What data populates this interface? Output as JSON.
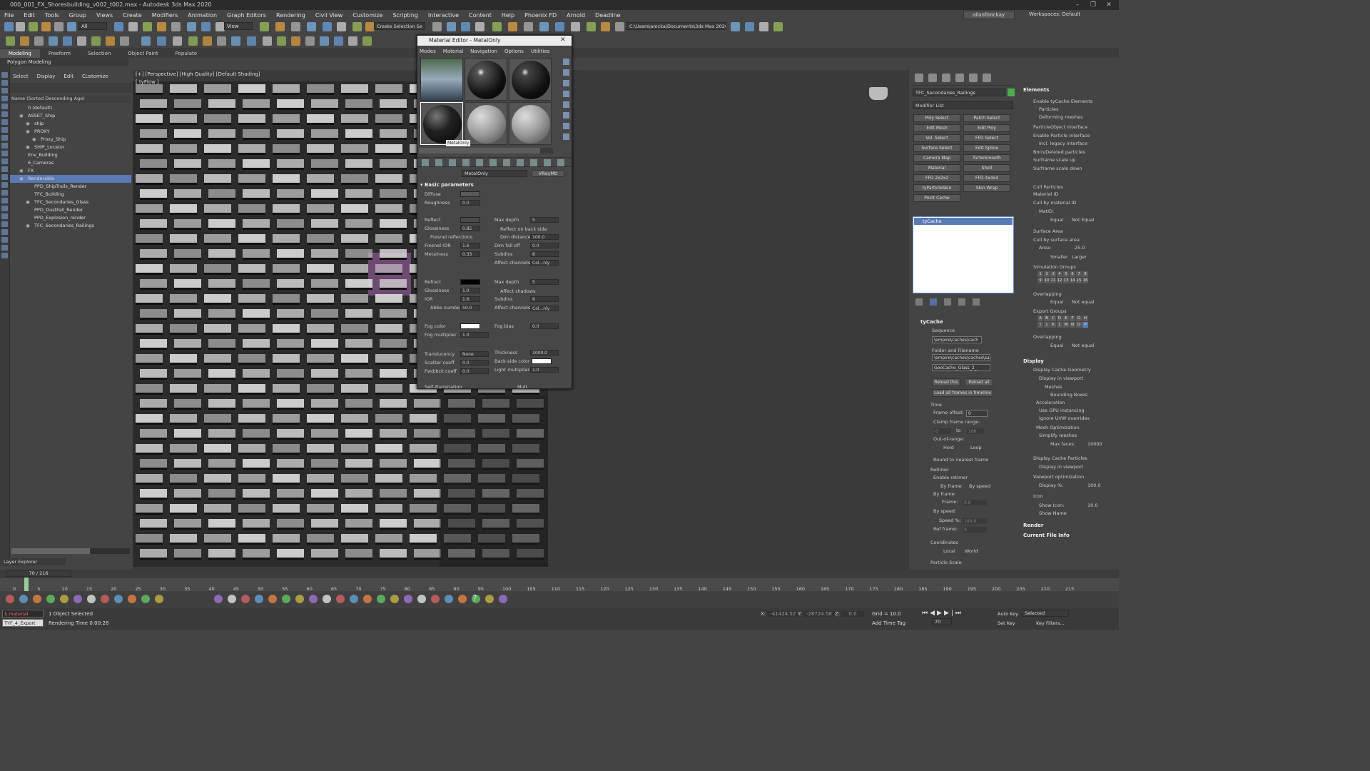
{
  "title_bar": {
    "text": "000_001_FX_Shoresbuilding_v002_t002.max - Autodesk 3ds Max 2020"
  },
  "menu": [
    "File",
    "Edit",
    "Tools",
    "Group",
    "Views",
    "Create",
    "Modifiers",
    "Animation",
    "Graph Editors",
    "Rendering",
    "Civil View",
    "Customize",
    "Scripting",
    "Interactive",
    "Content",
    "Help",
    "Phoenix FD",
    "Arnold",
    "Deadline"
  ],
  "user": {
    "name": "allanftmckay",
    "workspaces_label": "Workspaces:",
    "workspace": "Default"
  },
  "toolbar": {
    "selection_filter": "All",
    "view_dropdown": "View",
    "create_selection_set": "Create Selection Se",
    "path": "C:\\Users\\amcka\\Documents\\3ds Max 2020"
  },
  "ribbon": {
    "tabs": [
      "Modeling",
      "Freeform",
      "Selection",
      "Object Paint",
      "Populate"
    ],
    "active_sub": "Polygon Modeling"
  },
  "scene_explorer": {
    "menu": [
      "Select",
      "Display",
      "Edit",
      "Customize"
    ],
    "header": "Name (Sorted Descending Age)",
    "rows": [
      {
        "label": "0 (default)",
        "indent": 1,
        "eye": false
      },
      {
        "label": "ASSET_Ship",
        "indent": 1,
        "eye": true
      },
      {
        "label": "ship",
        "indent": 2,
        "eye": true
      },
      {
        "label": "PROXY",
        "indent": 2,
        "eye": true
      },
      {
        "label": "Proxy_Ship",
        "indent": 3,
        "eye": true
      },
      {
        "label": "SHIP_Locator",
        "indent": 2,
        "eye": true
      },
      {
        "label": "Env_Building",
        "indent": 1,
        "eye": false
      },
      {
        "label": "6_Cameras",
        "indent": 1,
        "eye": false
      },
      {
        "label": "FX",
        "indent": 1,
        "eye": true
      },
      {
        "label": "Renderable",
        "indent": 1,
        "eye": true,
        "selected": true
      },
      {
        "label": "PPD_ShipTrails_Render",
        "indent": 2,
        "eye": false
      },
      {
        "label": "TFC_Building",
        "indent": 2,
        "eye": false
      },
      {
        "label": "TFC_Secondaries_Glass",
        "indent": 2,
        "eye": true
      },
      {
        "label": "PPD_DustFall_Render",
        "indent": 2,
        "eye": false
      },
      {
        "label": "PPD_Explosion_render",
        "indent": 2,
        "eye": false
      },
      {
        "label": "TFC_Secondaries_Railings",
        "indent": 2,
        "eye": true
      }
    ],
    "layer_explorer": "Layer Explorer"
  },
  "viewport": {
    "label": "[+] [Perspective] [High Quality] [Default Shading]",
    "sublabel": "[ tyFlow ]"
  },
  "material_editor": {
    "title": "Material Editor - MetalOnly",
    "menu": [
      "Modes",
      "Material",
      "Navigation",
      "Options",
      "Utilities"
    ],
    "tooltip": "MetalOnly",
    "material_name": "MetalOnly",
    "material_type": "VRayMtl",
    "rollout": "Basic parameters",
    "diffuse": "Diffuse",
    "roughness": {
      "label": "Roughness",
      "value": "0.0"
    },
    "reflect": {
      "label": "Reflect",
      "max_depth_label": "Max depth",
      "max_depth": "5"
    },
    "glossiness": {
      "label": "Glossiness",
      "value": "0.85",
      "reflect_backside": "Reflect on back side"
    },
    "fresnel": "Fresnel reflections",
    "dim_distance": {
      "label": "Dim distance",
      "value": "100.0"
    },
    "fresnel_ior": {
      "label": "Fresnel IOR",
      "value": "1.6",
      "dim_falloff": "Dim fall off",
      "dim_falloff_value": "0.0"
    },
    "metalness": {
      "label": "Metalness",
      "value": "0.33",
      "subdivs": "Subdivs",
      "subdivs_value": "8"
    },
    "affect_channels_label": "Affect channels",
    "affect_channels": "Col...nly",
    "refract": {
      "label": "Refract",
      "max_depth_label": "Max depth",
      "max_depth": "5"
    },
    "refr_glossiness": {
      "label": "Glossiness",
      "value": "1.0",
      "affect_shadows": "Affect shadows"
    },
    "ior": {
      "label": "IOR",
      "value": "1.6",
      "subdivs": "Subdivs",
      "subdivs_value": "8"
    },
    "abbe": {
      "label": "Abbe number",
      "value": "50.0"
    },
    "fog_color": "Fog color",
    "fog_bias": {
      "label": "Fog bias",
      "value": "0.0"
    },
    "fog_multiplier": {
      "label": "Fog multiplier",
      "value": "1.0"
    },
    "translucency": {
      "label": "Translucency",
      "value": "None",
      "thickness": "Thickness",
      "thickness_value": "1000.0"
    },
    "scatter": {
      "label": "Scatter coeff",
      "value": "0.0",
      "backside": "Back-side color"
    },
    "fwdbck": {
      "label": "Fwd/bck coeff",
      "value": "0.0",
      "light_mult": "Light multiplier",
      "light_mult_value": "1.0"
    },
    "self_illum": "Self-illumination",
    "multi": "Mult"
  },
  "command_panel": {
    "object_name": "TFC_Secondaries_Railings",
    "modifier_list": "Modifier List",
    "buttons": [
      "Poly Select",
      "Patch Select",
      "Edit Mesh",
      "Edit Poly",
      "Vol. Select",
      "FFD Select",
      "Surface Select",
      "Edit Spline",
      "Camera Map",
      "TurboSmooth",
      "Material",
      "Shell",
      "FFD 2x2x2",
      "FFD 4x4x4",
      "tyParticleSkin",
      "Skin Wrap",
      "Point Cache",
      ""
    ],
    "stack_item": "tyCache",
    "tycache": {
      "title": "tyCache",
      "sequence": "Sequence",
      "sequence_path": "\\empire\\caches\\cach",
      "folder_label": "Folder and Filename",
      "folder_path": "\\empire\\caches\\caches\\sa",
      "file": "GeoCache_Glass_2_",
      "reload_this": "Reload this",
      "reload_all": "Reload all",
      "load_all": "Load all frames in timeline",
      "time": "Time",
      "frame_offset": "Frame offset:",
      "frame_offset_value": "0",
      "clamp": "Clamp frame range:",
      "clamp_from": "0",
      "clamp_to_label": "to",
      "clamp_to": "100",
      "out_of_range": "Out-of-range:",
      "hold": "Hold",
      "loop": "Loop",
      "round": "Round to nearest frame",
      "retimer": "Retimer",
      "enable_retimer": "Enable retimer",
      "by_frame": "By frame",
      "by_speed": "By speed",
      "by_frame_label": "By frame:",
      "frame_label": "Frame:",
      "frame_value": "0.0",
      "by_speed_label": "By speed:",
      "speed_pct": "Speed %:",
      "speed_value": "100.0",
      "ref_frame": "Ref frame:",
      "ref_value": "0",
      "coordinates": "Coordinates",
      "local": "Local",
      "world": "World",
      "particle_scale": "Particle Scale"
    },
    "elements": {
      "title": "Elements",
      "enable": "Enable tyCache Elements",
      "particles": "Particles",
      "deforming": "Deforming meshes",
      "pobj_iface": "ParticleObject Interface",
      "enable_pi": "Enable Particle Interface",
      "incl_legacy": "Incl. legacy interface",
      "born_del": "Born/Deleted particles",
      "scale_up": "Surframe scale up",
      "scale_down": "Surframe scale down",
      "cull": "Cull Particles",
      "material_id": "Material ID",
      "cull_matid": "Cull by material ID",
      "matid": "MatID:",
      "equal": "Equal",
      "not_equal": "Not Equal",
      "surface_area": "Surface Area",
      "cull_surf": "Cull by surface area",
      "area": "Area:",
      "area_value": "25.0",
      "smaller": "Smaller",
      "larger": "Larger",
      "sim_groups": "Simulation Groups",
      "overlapping": "Overlapping",
      "equal2": "Equal",
      "not_equal2": "Not equal",
      "export_groups": "Export Groups",
      "overlapping2": "Overlapping",
      "equal3": "Equal",
      "not_equal3": "Not equal"
    },
    "display": {
      "title": "Display",
      "cache_geom": "Display Cache Geometry",
      "in_viewport": "Display in viewport",
      "meshes": "Meshes",
      "bboxes": "Bounding Boxes",
      "accel": "Acceleration",
      "gpu": "Use GPU instancing",
      "uvw": "Ignore UVW overrides",
      "mesh_opt": "Mesh Optimization",
      "simplify": "Simplify meshes",
      "max_faces": "Max faces:",
      "max_faces_value": "10000",
      "cache_particles": "Display Cache Particles",
      "in_viewport2": "Display in viewport",
      "vp_opt": "Viewport optimization",
      "display_pct": "Display %:",
      "display_pct_value": "100.0",
      "icon": "Icon",
      "show_icon": "Show Icon:",
      "icon_size": "10.0",
      "show_name": "Show Name"
    },
    "render": "Render",
    "current_file": "Current File Info"
  },
  "timeline": {
    "frame": "70 / 216",
    "ticks": [
      "0",
      "5",
      "10",
      "15",
      "20",
      "25",
      "30",
      "35",
      "40",
      "45",
      "50",
      "55",
      "60",
      "65",
      "70",
      "75",
      "80",
      "85",
      "90",
      "95",
      "100",
      "105",
      "110",
      "115",
      "120",
      "125",
      "130",
      "135",
      "140",
      "145",
      "150",
      "155",
      "160",
      "165",
      "170",
      "175",
      "180",
      "185",
      "190",
      "195",
      "200",
      "205",
      "210",
      "215"
    ]
  },
  "status": {
    "script1": "$.material",
    "script2": "TYF_4_Export",
    "selected": "1 Object Selected",
    "render_time": "Rendering Time  0:00:28",
    "x_label": "X:",
    "x": "-41424.52",
    "y_label": "Y:",
    "y": "-28724.58",
    "z_label": "Z:",
    "z": "0.0",
    "grid": "Grid = 10.0",
    "add_time_tag": "Add Time Tag",
    "auto_key": "Auto Key",
    "set_key": "Set Key",
    "selected_dd": "Selected",
    "key_filters": "Key Filters...",
    "frame_field": "70"
  }
}
